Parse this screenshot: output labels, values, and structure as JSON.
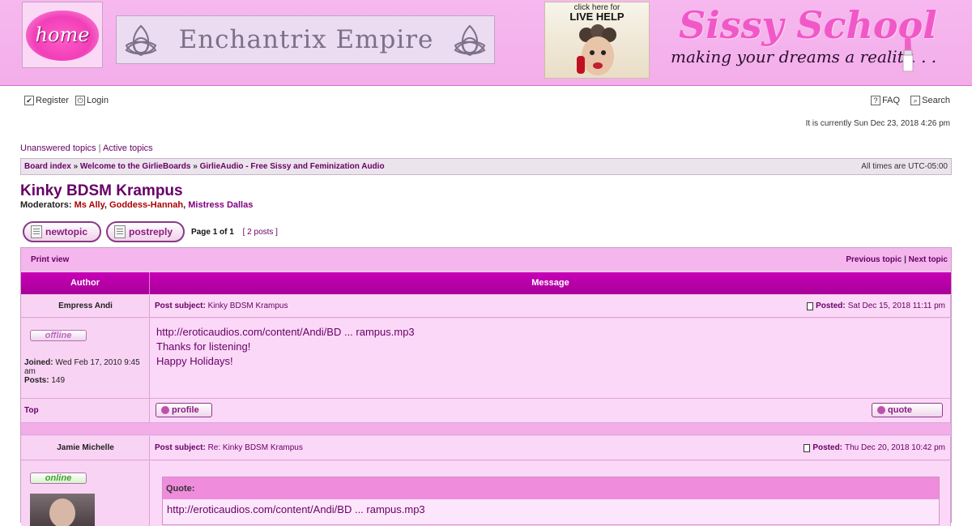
{
  "header": {
    "home_label": "home",
    "enchantrix_title": "Enchantrix Empire",
    "livehelp_small": "click here for",
    "livehelp_big": "LIVE HELP",
    "sissy_title": "Sissy School",
    "sissy_subtitle": "making your dreams a reality. . ."
  },
  "nav": {
    "register": "Register",
    "login": "Login",
    "faq": "FAQ",
    "search": "Search",
    "current_time": "It is currently Sun Dec 23, 2018 4:26 pm"
  },
  "quick_links": {
    "unanswered": "Unanswered topics",
    "separator": "|",
    "active": "Active topics"
  },
  "breadcrumbs": {
    "board_index": "Board index",
    "sep": "»",
    "forum1": "Welcome to the GirlieBoards",
    "forum2": "GirlieAudio - Free Sissy and Feminization Audio",
    "timezone": "All times are UTC-05:00"
  },
  "topic": {
    "title": "Kinky BDSM Krampus",
    "moderators_label": "Moderators:",
    "moderators": [
      "Ms Ally",
      "Goddess-Hannah",
      "Mistress Dallas"
    ],
    "new_topic": "newtopic",
    "post_reply": "postreply",
    "page_label": "Page",
    "page_current": "1",
    "page_of": "of",
    "page_total": "1",
    "posts_count": "[ 2 posts ]"
  },
  "table": {
    "print_view": "Print view",
    "previous_topic": "Previous topic",
    "topic_sep": "|",
    "next_topic": "Next topic",
    "col_author": "Author",
    "col_message": "Message"
  },
  "posts": [
    {
      "author": "Empress Andi",
      "status": "offline",
      "subject_label": "Post subject:",
      "subject": "Kinky BDSM Krampus",
      "posted_label": "Posted:",
      "posted": "Sat Dec 15, 2018 11:11 pm",
      "joined_label": "Joined:",
      "joined": "Wed Feb 17, 2010 9:45 am",
      "posts_label": "Posts:",
      "posts": "149",
      "lines": [
        "http://eroticaudios.com/content/Andi/BD ... rampus.mp3",
        "Thanks for listening!",
        "Happy Holidays!"
      ],
      "top_link": "Top",
      "profile_btn": "profile",
      "quote_btn": "quote"
    },
    {
      "author": "Jamie Michelle",
      "status": "online",
      "subject_label": "Post subject:",
      "subject": "Re: Kinky BDSM Krampus",
      "posted_label": "Posted:",
      "posted": "Thu Dec 20, 2018 10:42 pm",
      "quote_label": "Quote:",
      "quote_text": "http://eroticaudios.com/content/Andi/BD ... rampus.mp3"
    }
  ],
  "colors": {
    "header_pink": "#f3aeea",
    "table_header_magenta": "#b800a8",
    "link_purple": "#660066",
    "moderator_red": "#aa0000"
  }
}
